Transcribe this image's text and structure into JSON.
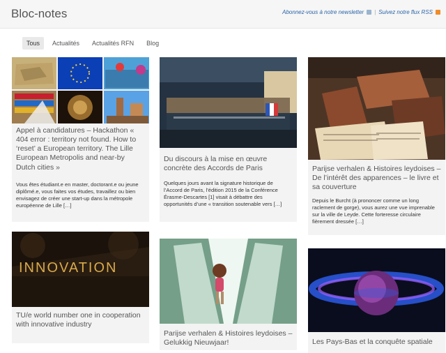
{
  "header": {
    "site_title": "Bloc-notes",
    "newsletter": "Abonnez-vous à notre newsletter",
    "separator": "|",
    "rss": "Suivez notre flux RSS"
  },
  "filters": [
    {
      "label": "Tous",
      "active": true
    },
    {
      "label": "Actualités",
      "active": false
    },
    {
      "label": "Actualités RFN",
      "active": false
    },
    {
      "label": "Blog",
      "active": false
    }
  ],
  "cards": [
    {
      "title": "Appel à candidatures – Hackathon « 404 error : territory not found. How to ‘reset’ a European territory. The Lille European Metropolis and near-by Dutch cities »",
      "excerpt": "Vous êtes étudiant.e en master, doctorant.e ou jeune diplômé.e, vous faites vos études, travaillez ou bien envisagez de créer une start-up dans la métropole européenne de Lille […]"
    },
    {
      "title": "Du discours à la mise en œuvre concrète des Accords de Paris",
      "excerpt": "Quelques jours avant la signature historique de l’Accord de Paris, l’édition 2015 de la Conférence Érasme-Descartes [1] visait à débattre des opportunités d’une « transition soutenable vers […]"
    },
    {
      "title": "Parijse verhalen & Histoires leydoises – De l’intérêt des apparences – le livre et sa couverture",
      "excerpt": "Depuis le Burcht (à prononcer comme un long raclement de gorge), vous aurez une vue imprenable sur la ville de Leyde. Cette forteresse circulaire fièrement dressée […]"
    },
    {
      "title": "TU/e world number one in cooperation with innovative industry",
      "image_text": "INNOVATION"
    },
    {
      "title": "Parijse verhalen & Histoires leydoises – Gelukkig Nieuwjaar!"
    },
    {
      "title": "Les Pays-Bas et la conquête spatiale"
    }
  ],
  "colors": {
    "accent": "#2a63a6",
    "rss": "#ef8d2b",
    "card_bg": "#f3f3f3"
  }
}
